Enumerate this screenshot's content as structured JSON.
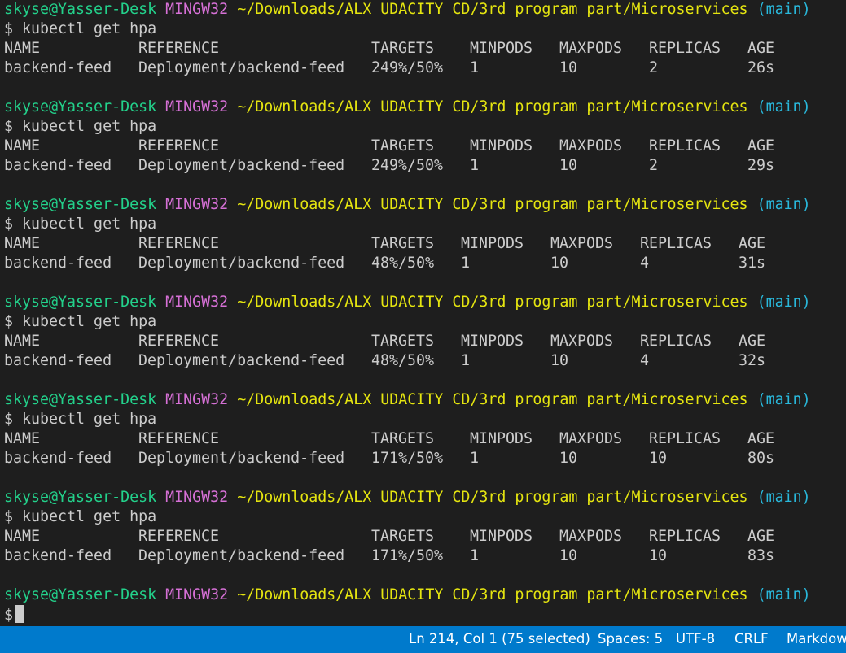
{
  "prompt": {
    "user": "skyse",
    "host": "@Yasser-Desk",
    "shell": "MINGW32",
    "path": "~/Downloads/ALX UDACITY CD/3rd program part/Microservices",
    "branch": "(main)"
  },
  "command": "$ kubectl get hpa",
  "final_prompt_symbol": "$",
  "headers": [
    "NAME",
    "REFERENCE",
    "TARGETS",
    "MINPODS",
    "MAXPODS",
    "REPLICAS",
    "AGE"
  ],
  "runs": [
    {
      "row": [
        "backend-feed",
        "Deployment/backend-feed",
        "249%/50%",
        "1",
        "10",
        "2",
        "26s"
      ]
    },
    {
      "row": [
        "backend-feed",
        "Deployment/backend-feed",
        "249%/50%",
        "1",
        "10",
        "2",
        "29s"
      ]
    },
    {
      "row": [
        "backend-feed",
        "Deployment/backend-feed",
        "48%/50%",
        "1",
        "10",
        "4",
        "31s"
      ]
    },
    {
      "row": [
        "backend-feed",
        "Deployment/backend-feed",
        "48%/50%",
        "1",
        "10",
        "4",
        "32s"
      ]
    },
    {
      "row": [
        "backend-feed",
        "Deployment/backend-feed",
        "171%/50%",
        "1",
        "10",
        "10",
        "80s"
      ]
    },
    {
      "row": [
        "backend-feed",
        "Deployment/backend-feed",
        "171%/50%",
        "1",
        "10",
        "10",
        "83s"
      ]
    }
  ],
  "statusbar": {
    "position": "Ln 214, Col 1 (75 selected)",
    "spaces": "Spaces: 5",
    "encoding": "UTF-8",
    "eol": "CRLF",
    "language": "Markdown"
  }
}
